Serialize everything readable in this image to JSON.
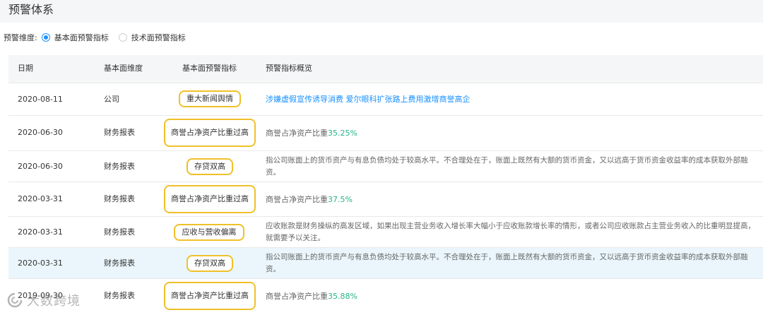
{
  "page": {
    "title": "预警体系"
  },
  "filter": {
    "label": "预警维度:",
    "options": [
      {
        "label": "基本面预警指标",
        "checked": true
      },
      {
        "label": "技术面预警指标",
        "checked": false
      }
    ]
  },
  "table": {
    "headers": {
      "date": "日期",
      "dimension": "基本面维度",
      "indicator": "基本面预警指标",
      "overview": "预警指标概览"
    },
    "rows": [
      {
        "date": "2020-08-11",
        "dimension": "公司",
        "indicator": "重大新闻舆情",
        "overview": "涉嫌虚假宣传诱导消费 爱尔眼科扩张路上费用激增商誉高企"
      },
      {
        "date": "2020-06-30",
        "dimension": "财务报表",
        "indicator": "商誉占净资产比重过高",
        "overview_prefix": "商誉占净资产比重",
        "overview_value": "35.25%"
      },
      {
        "date": "2020-06-30",
        "dimension": "财务报表",
        "indicator": "存贷双高",
        "overview": "指公司账面上的货币资产与有息负债均处于较高水平。不合理处在于，账面上既然有大额的货币资金，又以远高于货币资金收益率的成本获取外部融资。"
      },
      {
        "date": "2020-03-31",
        "dimension": "财务报表",
        "indicator": "商誉占净资产比重过高",
        "overview_prefix": "商誉占净资产比重",
        "overview_value": "37.5%"
      },
      {
        "date": "2020-03-31",
        "dimension": "财务报表",
        "indicator": "应收与营收偏离",
        "overview": "应收账款是财务操纵的高发区域，如果出现主营业务收入增长率大幅小于应收账款增长率的情形，或者公司应收账款占主营业务收入的比重明显提高，就需要予以关注。"
      },
      {
        "date": "2020-03-31",
        "dimension": "财务报表",
        "indicator": "存贷双高",
        "overview": "指公司账面上的货币资产与有息负债均处于较高水平。不合理处在于，账面上既然有大额的货币资金，又以远高于货币资金收益率的成本获取外部融资。"
      },
      {
        "date": "2019-09-30",
        "dimension": "财务报表",
        "indicator": "商誉占净资产比重过高",
        "overview_prefix": "商誉占净资产比重",
        "overview_value": "35.88%"
      }
    ]
  },
  "watermark": {
    "text": "大数跨境"
  },
  "colors": {
    "accent": "#1e90ff",
    "link": "#1890ff",
    "tag_border": "#f0c02a",
    "green": "#27b48a",
    "highlight_row": "#eaf6fc"
  }
}
